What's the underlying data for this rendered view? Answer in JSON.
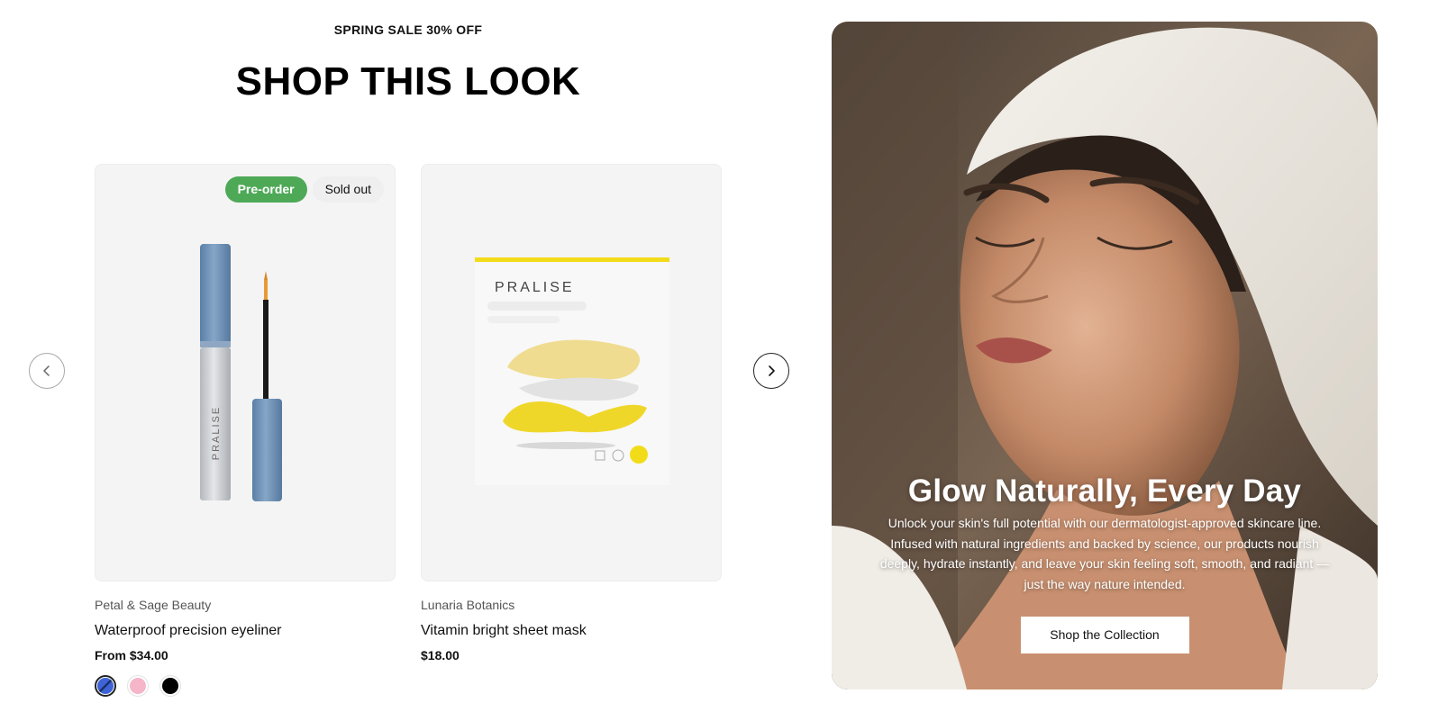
{
  "header": {
    "eyebrow": "SPRING SALE 30% OFF",
    "title": "SHOP THIS LOOK"
  },
  "carousel": {
    "prev_icon": "chevron-left-icon",
    "next_icon": "chevron-right-icon"
  },
  "products": [
    {
      "badges": {
        "preorder": "Pre-order",
        "sold_out": "Sold out"
      },
      "image_brand": "PRALISE",
      "vendor": "Petal & Sage Beauty",
      "name": "Waterproof precision eyeliner",
      "price": "From $34.00",
      "swatches": [
        {
          "color": "#3d63d6",
          "selected": true
        },
        {
          "color": "#f4b6c8",
          "selected": false
        },
        {
          "color": "#000000",
          "selected": false
        }
      ]
    },
    {
      "image_brand": "PRALISE",
      "vendor": "Lunaria Botanics",
      "name": "Vitamin bright sheet mask",
      "price": "$18.00"
    }
  ],
  "hero": {
    "title": "Glow Naturally, Every Day",
    "text": "Unlock your skin's full potential with our dermatologist-approved skincare line. Infused with natural ingredients and backed by science, our products nourish deeply, hydrate instantly, and leave your skin feeling soft, smooth, and radiant — just the way nature intended.",
    "button": "Shop the Collection"
  },
  "colors": {
    "preorder_badge": "#4ea957",
    "accent_yellow": "#f2dc1a",
    "eyeliner_blue": "#6f93b9"
  }
}
